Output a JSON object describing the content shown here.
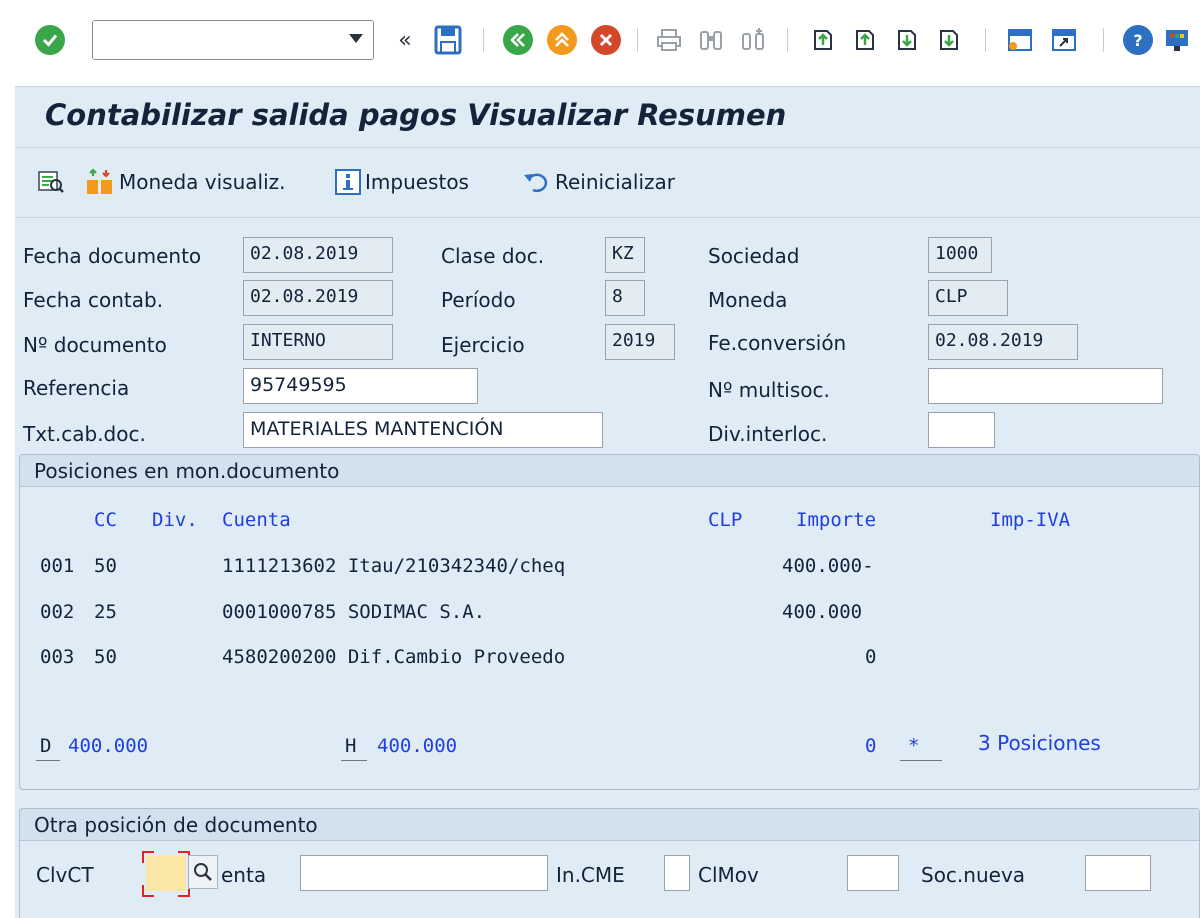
{
  "toolbar": {
    "command_value": "",
    "colors": {
      "green": "#3aa64a",
      "orange": "#f29a1e",
      "red": "#d3472b",
      "blue": "#2d6fc0"
    }
  },
  "title": "Contabilizar salida pagos Visualizar Resumen",
  "app_toolbar": {
    "currency_label": "Moneda visualiz.",
    "taxes_label": "Impuestos",
    "reset_label": "Reinicializar"
  },
  "header": {
    "fecha_documento": {
      "label": "Fecha documento",
      "value": "02.08.2019"
    },
    "fecha_contab": {
      "label": "Fecha contab.",
      "value": "02.08.2019"
    },
    "no_documento": {
      "label": "Nº documento",
      "value": "INTERNO"
    },
    "referencia": {
      "label": "Referencia",
      "value": "95749595"
    },
    "txt_cab_doc": {
      "label": "Txt.cab.doc.",
      "value": "MATERIALES MANTENCIÓN"
    },
    "clase_doc": {
      "label": "Clase doc.",
      "value": "KZ"
    },
    "periodo": {
      "label": "Período",
      "value": "8"
    },
    "ejercicio": {
      "label": "Ejercicio",
      "value": "2019"
    },
    "sociedad": {
      "label": "Sociedad",
      "value": "1000"
    },
    "moneda": {
      "label": "Moneda",
      "value": "CLP"
    },
    "fe_conversion": {
      "label": "Fe.conversión",
      "value": "02.08.2019"
    },
    "no_multisoc": {
      "label": "Nº multisoc.",
      "value": ""
    },
    "div_interloc": {
      "label": "Div.interloc.",
      "value": ""
    }
  },
  "positions": {
    "title": "Posiciones en mon.documento",
    "columns": {
      "cc": "CC",
      "div": "Div.",
      "cuenta": "Cuenta",
      "currency": "CLP",
      "importe": "Importe",
      "imp_iva": "Imp-IVA"
    },
    "rows": [
      {
        "pos": "001",
        "cc": "50",
        "cuenta": "1111213602 Itau/210342340/cheq",
        "importe": "400.000-"
      },
      {
        "pos": "002",
        "cc": "25",
        "cuenta": "0001000785 SODIMAC S.A.",
        "importe": "400.000"
      },
      {
        "pos": "003",
        "cc": "50",
        "cuenta": "4580200200 Dif.Cambio Proveedo",
        "importe": "0"
      }
    ],
    "totals": {
      "d_label": "D",
      "d_value": "400.000",
      "h_label": "H",
      "h_value": "400.000",
      "saldo": "0",
      "star": "*",
      "count": "3",
      "count_label": "Posiciones"
    }
  },
  "other_position": {
    "title": "Otra posición de documento",
    "clvct_label": "ClvCT",
    "clvct_value": "",
    "cuenta_label": "enta",
    "cuenta_value": "",
    "in_cme_label": "In.CME",
    "in_cme_value": "",
    "clmov_label": "ClMov",
    "clmov_value": "",
    "soc_nueva_label": "Soc.nueva",
    "soc_nueva_value": ""
  }
}
